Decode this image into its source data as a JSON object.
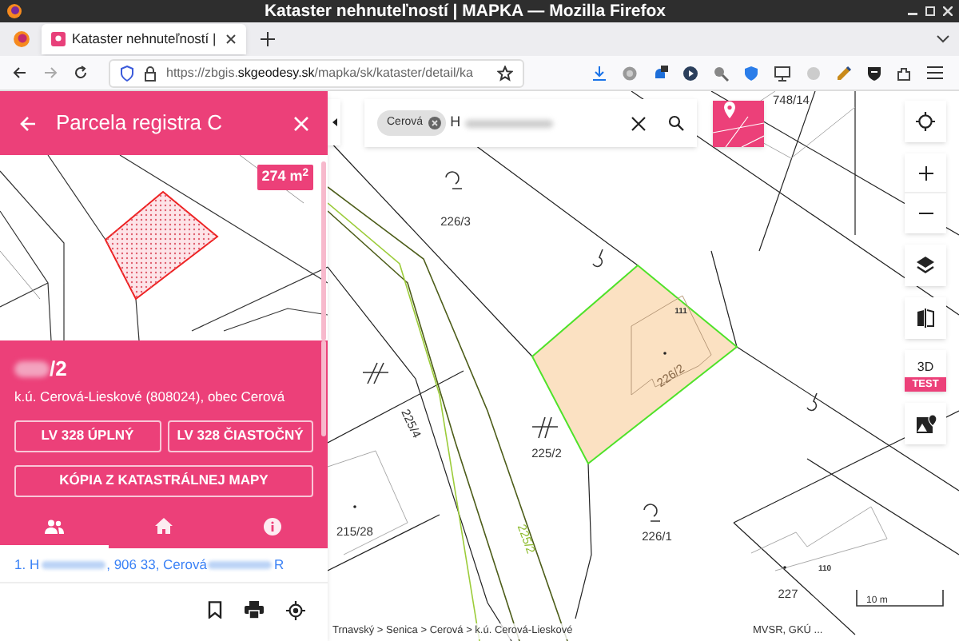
{
  "window": {
    "title": "Kataster nehnuteľností | MAPKA — Mozilla Firefox"
  },
  "browser": {
    "tab": {
      "title": "Kataster nehnuteľností |",
      "selected": true
    },
    "url_host": "https://zbgis.",
    "url_domain": "skgeodesy.sk",
    "url_path": "/mapka/sk/kataster/detail/ka"
  },
  "panel": {
    "title": "Parcela registra C",
    "area_badge": "274 m$^{2}$",
    "parcel_number": "/2",
    "location": "k.ú. Cerová-Lieskové (808024), obec Cerová",
    "buttons": [
      {
        "label": "LV 328 ÚPLNÝ",
        "wide": false
      },
      {
        "label": "LV 328 ČIASTOČNÝ",
        "wide": false
      },
      {
        "label": "KÓPIA Z KATASTRÁLNEJ MAPY",
        "wide": true
      }
    ],
    "tabs": [
      {
        "kind": "owners",
        "selected": true
      },
      {
        "kind": "house",
        "selected": false
      },
      {
        "kind": "info",
        "selected": false
      }
    ],
    "owner_segments": [
      "1. H",
      ", 906 33, Cerová",
      "R"
    ]
  },
  "search": {
    "chip": "Cerová",
    "value": "H"
  },
  "map": {
    "labels": [
      {
        "text": "748/14"
      },
      {
        "text": "226/3"
      },
      {
        "text": "111"
      },
      {
        "text": "226/2"
      },
      {
        "text": "225/4"
      },
      {
        "text": "225/2"
      },
      {
        "text": "215/28"
      },
      {
        "text": "226/1"
      },
      {
        "text": "225/2"
      },
      {
        "text": "110"
      },
      {
        "text": "227"
      }
    ],
    "scale": "10 m",
    "breadcrumb": "Trnavský > Senica > Cerová > k.ú. Cerová-Lieskové",
    "attribution": "MVSR, GKÚ ..."
  },
  "controls": {
    "three_d": "3D",
    "badge": "TEST"
  }
}
